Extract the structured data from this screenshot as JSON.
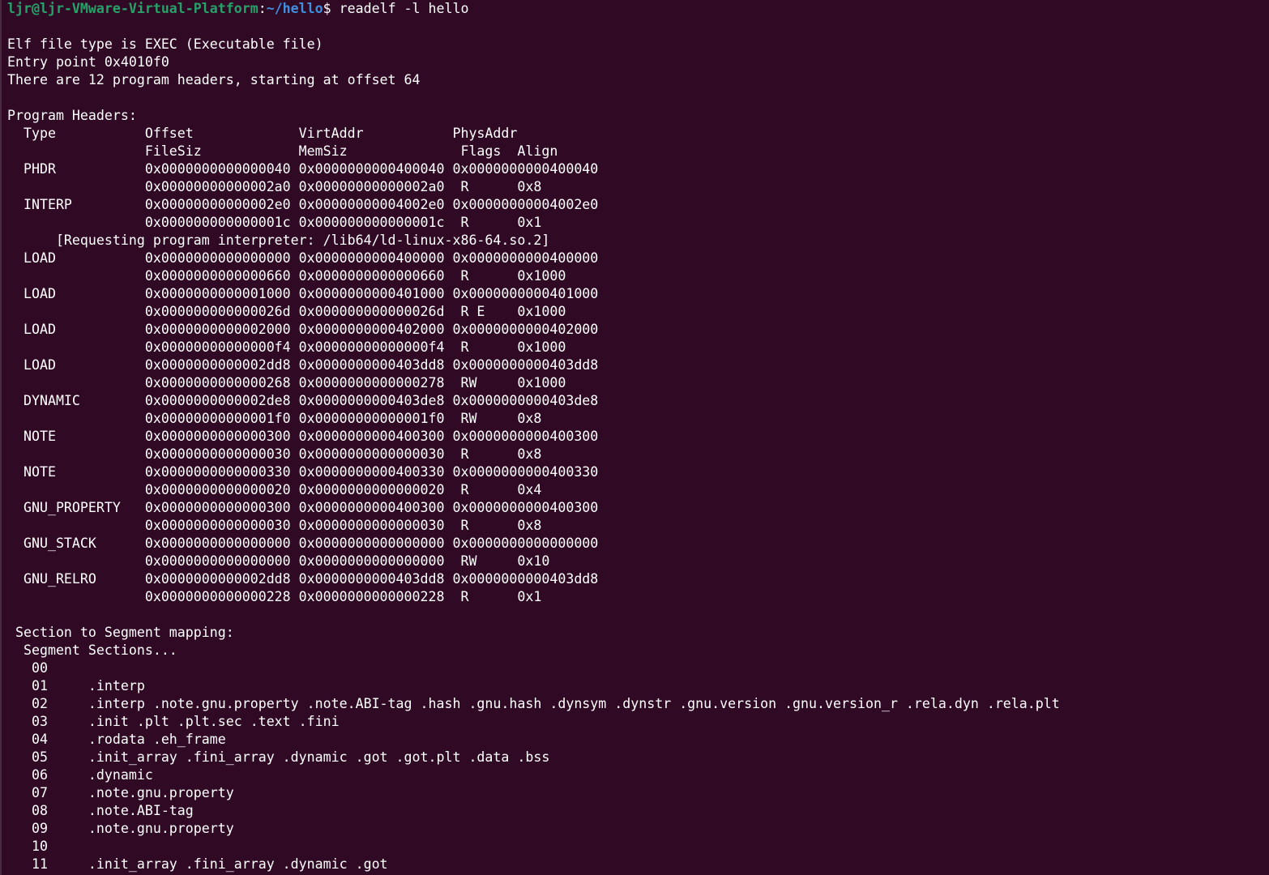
{
  "prompt": {
    "user_host": "ljr@ljr-VMware-Virtual-Platform",
    "separator": ":",
    "path": "~/hello",
    "symbol": "$",
    "command": " readelf -l hello"
  },
  "colors": {
    "background": "#300a24",
    "text": "#ffffff",
    "prompt_user": "#26a269",
    "prompt_path": "#3f8fe0"
  },
  "output_lines": [
    "",
    "Elf file type is EXEC (Executable file)",
    "Entry point 0x4010f0",
    "There are 12 program headers, starting at offset 64",
    "",
    "Program Headers:",
    "  Type           Offset             VirtAddr           PhysAddr",
    "                 FileSiz            MemSiz              Flags  Align",
    "  PHDR           0x0000000000000040 0x0000000000400040 0x0000000000400040",
    "                 0x00000000000002a0 0x00000000000002a0  R      0x8",
    "  INTERP         0x00000000000002e0 0x00000000004002e0 0x00000000004002e0",
    "                 0x000000000000001c 0x000000000000001c  R      0x1",
    "      [Requesting program interpreter: /lib64/ld-linux-x86-64.so.2]",
    "  LOAD           0x0000000000000000 0x0000000000400000 0x0000000000400000",
    "                 0x0000000000000660 0x0000000000000660  R      0x1000",
    "  LOAD           0x0000000000001000 0x0000000000401000 0x0000000000401000",
    "                 0x000000000000026d 0x000000000000026d  R E    0x1000",
    "  LOAD           0x0000000000002000 0x0000000000402000 0x0000000000402000",
    "                 0x00000000000000f4 0x00000000000000f4  R      0x1000",
    "  LOAD           0x0000000000002dd8 0x0000000000403dd8 0x0000000000403dd8",
    "                 0x0000000000000268 0x0000000000000278  RW     0x1000",
    "  DYNAMIC        0x0000000000002de8 0x0000000000403de8 0x0000000000403de8",
    "                 0x00000000000001f0 0x00000000000001f0  RW     0x8",
    "  NOTE           0x0000000000000300 0x0000000000400300 0x0000000000400300",
    "                 0x0000000000000030 0x0000000000000030  R      0x8",
    "  NOTE           0x0000000000000330 0x0000000000400330 0x0000000000400330",
    "                 0x0000000000000020 0x0000000000000020  R      0x4",
    "  GNU_PROPERTY   0x0000000000000300 0x0000000000400300 0x0000000000400300",
    "                 0x0000000000000030 0x0000000000000030  R      0x8",
    "  GNU_STACK      0x0000000000000000 0x0000000000000000 0x0000000000000000",
    "                 0x0000000000000000 0x0000000000000000  RW     0x10",
    "  GNU_RELRO      0x0000000000002dd8 0x0000000000403dd8 0x0000000000403dd8",
    "                 0x0000000000000228 0x0000000000000228  R      0x1",
    "",
    " Section to Segment mapping:",
    "  Segment Sections...",
    "   00     ",
    "   01     .interp ",
    "   02     .interp .note.gnu.property .note.ABI-tag .hash .gnu.hash .dynsym .dynstr .gnu.version .gnu.version_r .rela.dyn .rela.plt ",
    "   03     .init .plt .plt.sec .text .fini ",
    "   04     .rodata .eh_frame ",
    "   05     .init_array .fini_array .dynamic .got .got.plt .data .bss ",
    "   06     .dynamic ",
    "   07     .note.gnu.property ",
    "   08     .note.ABI-tag ",
    "   09     .note.gnu.property ",
    "   10     ",
    "   11     .init_array .fini_array .dynamic .got "
  ]
}
